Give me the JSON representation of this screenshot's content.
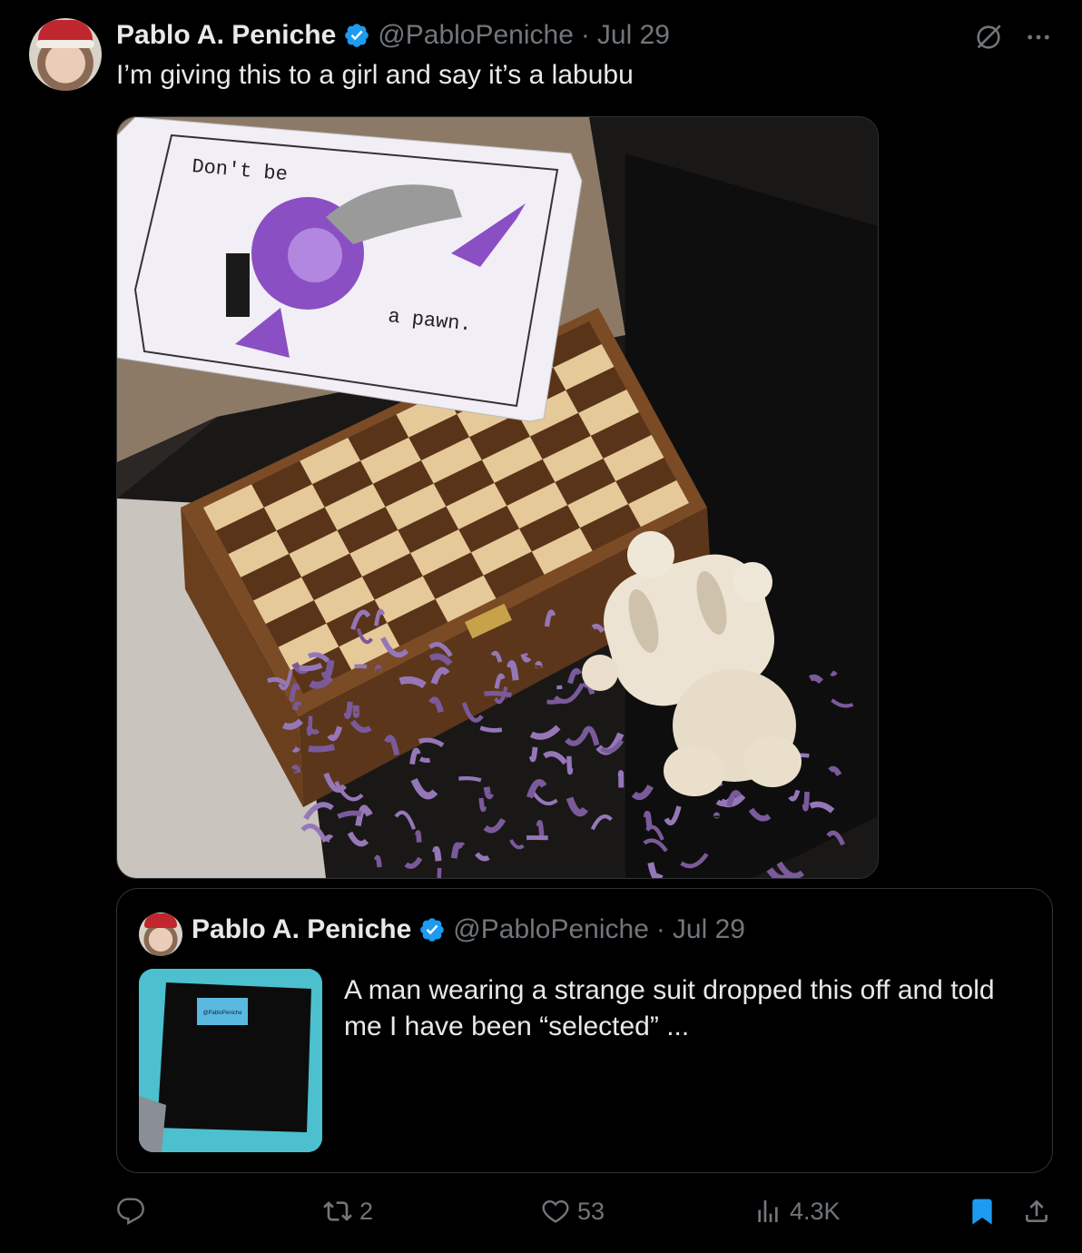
{
  "tweet": {
    "author_name": "Pablo A. Peniche",
    "handle": "@PabloPeniche",
    "separator": "·",
    "date": "Jul 29",
    "text": "I’m giving this to a girl and say it’s a labubu",
    "top_icons": [
      "grok-icon",
      "more-icon"
    ]
  },
  "media": {
    "card_text_top": "Don't be",
    "card_text_bottom": "a pawn."
  },
  "quoted_tweet": {
    "author_name": "Pablo A. Peniche",
    "handle": "@PabloPeniche",
    "separator": "·",
    "date": "Jul 29",
    "text": "A man wearing a strange suit dropped this off and told me I have been “selected” ...",
    "thumb_label": "@PabloPeniche"
  },
  "actions": {
    "reply_count": "",
    "retweet_count": "2",
    "like_count": "53",
    "views_count": "4.3K"
  },
  "colors": {
    "background": "#000000",
    "text": "#e7e9ea",
    "muted": "#71767b",
    "verified": "#1d9bf0",
    "bookmark_active": "#1d9bf0",
    "border": "#2f3336"
  }
}
